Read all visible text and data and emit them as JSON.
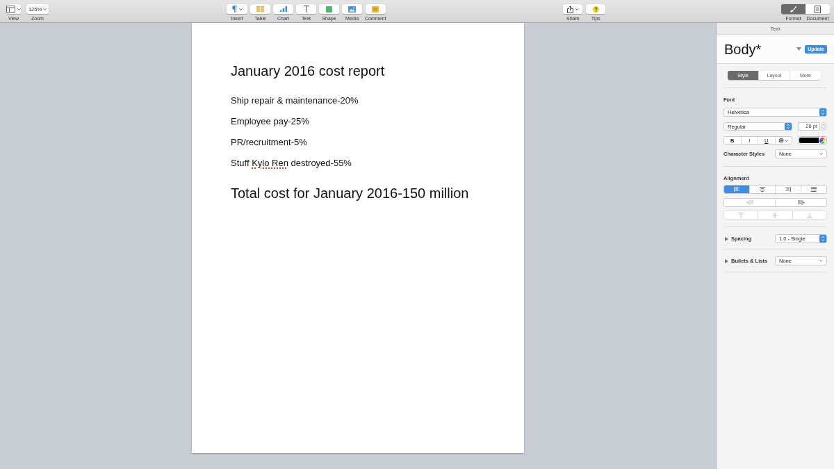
{
  "toolbar": {
    "left": [
      {
        "kind": "view",
        "label": "View"
      },
      {
        "kind": "zoom",
        "label": "Zoom",
        "value": "125%"
      }
    ],
    "insert": [
      {
        "kind": "insert",
        "label": "Insert"
      },
      {
        "kind": "table",
        "label": "Table"
      },
      {
        "kind": "chart",
        "label": "Chart"
      },
      {
        "kind": "text",
        "label": "Text"
      },
      {
        "kind": "shape",
        "label": "Shape"
      },
      {
        "kind": "media",
        "label": "Media"
      },
      {
        "kind": "comment",
        "label": "Comment"
      }
    ],
    "right": [
      {
        "kind": "share",
        "label": "Share"
      },
      {
        "kind": "tips",
        "label": "Tips"
      }
    ],
    "inspector": [
      {
        "kind": "format",
        "label": "Format",
        "selected": true
      },
      {
        "kind": "document",
        "label": "Document",
        "selected": false
      }
    ]
  },
  "document": {
    "title": "January 2016 cost report",
    "lines": [
      {
        "segments": [
          {
            "text": "Ship repair & maintenance-20%",
            "misspelled": false
          }
        ]
      },
      {
        "segments": [
          {
            "text": "Employee pay-25%",
            "misspelled": false
          }
        ]
      },
      {
        "segments": [
          {
            "text": "PR/recruitment-5%",
            "misspelled": false
          }
        ]
      },
      {
        "segments": [
          {
            "text": "Stuff ",
            "misspelled": false
          },
          {
            "text": "Kylo Ren",
            "misspelled": true
          },
          {
            "text": " destroyed-55%",
            "misspelled": false
          }
        ]
      }
    ],
    "total": "Total cost for January 2016-150 million"
  },
  "sidebar": {
    "header": "Text",
    "paragraph_style": {
      "name": "Body*",
      "button": "Update"
    },
    "tabs": [
      {
        "label": "Style",
        "selected": true
      },
      {
        "label": "Layout",
        "selected": false
      },
      {
        "label": "More",
        "selected": false
      }
    ],
    "font": {
      "label": "Font",
      "family": "Helvetica",
      "typeface": "Regular",
      "size": "26 pt",
      "format_buttons": [
        {
          "kind": "bold",
          "label": "B"
        },
        {
          "kind": "italic",
          "label": "I"
        },
        {
          "kind": "underline",
          "label": "U"
        },
        {
          "kind": "gear"
        }
      ]
    },
    "character_styles": {
      "label": "Character Styles",
      "value": "None"
    },
    "alignment": {
      "label": "Alignment",
      "horizontal": [
        {
          "kind": "left",
          "selected": true
        },
        {
          "kind": "center",
          "selected": false
        },
        {
          "kind": "right",
          "selected": false
        },
        {
          "kind": "justify",
          "selected": false
        }
      ],
      "indent": [
        {
          "kind": "outdent",
          "disabled": true
        },
        {
          "kind": "indent",
          "disabled": false
        }
      ],
      "vertical": [
        {
          "kind": "top",
          "disabled": true
        },
        {
          "kind": "middle",
          "disabled": true
        },
        {
          "kind": "bottom",
          "disabled": true
        }
      ]
    },
    "spacing": {
      "label": "Spacing",
      "value": "1.0 - Single",
      "expanded": false
    },
    "bullets": {
      "label": "Bullets & Lists",
      "value": "None",
      "expanded": false
    }
  }
}
